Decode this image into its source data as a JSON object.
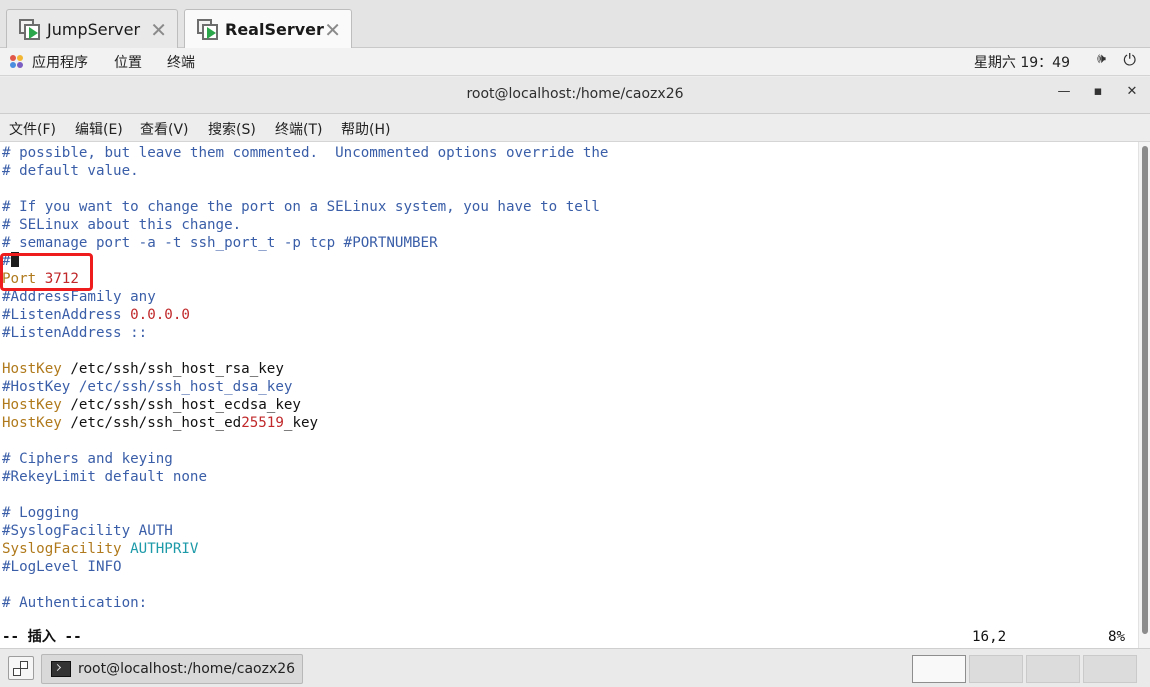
{
  "vm_tabs": [
    {
      "label": "JumpServer",
      "close": "✕",
      "active": false
    },
    {
      "label": "RealServer",
      "close": "✕",
      "active": true
    }
  ],
  "topbar": {
    "menus": [
      "应用程序",
      "位置",
      "终端"
    ],
    "clock": "星期六 19：49"
  },
  "window": {
    "title": "root@localhost:/home/caozx26",
    "minimize": "—",
    "maximize": "▪",
    "close": "✕"
  },
  "menubar": [
    "文件(F)",
    "编辑(E)",
    "查看(V)",
    "搜索(S)",
    "终端(T)",
    "帮助(H)"
  ],
  "editor": {
    "lines": [
      "# possible, but leave them commented.  Uncommented options override the",
      "# default value.",
      "",
      "# If you want to change the port on a SELinux system, you have to tell",
      "# SELinux about this change.",
      "# semanage port -a -t ssh_port_t -p tcp #PORTNUMBER",
      "#",
      [
        "Port",
        "3712"
      ],
      "#AddressFamily any",
      [
        "#ListenAddress",
        "0.0.0.0"
      ],
      "#ListenAddress ::",
      "",
      [
        "HostKey",
        "/etc/ssh/ssh_host_rsa_key"
      ],
      "#HostKey /etc/ssh/ssh_host_dsa_key",
      [
        "HostKey",
        "/etc/ssh/ssh_host_ecdsa_key"
      ],
      [
        "HostKey",
        "/etc/ssh/ssh_host_ed",
        "25519",
        "_key"
      ],
      "",
      "# Ciphers and keying",
      "#RekeyLimit default none",
      "",
      "# Logging",
      "#SyslogFacility AUTH",
      [
        "SyslogFacility",
        "AUTHPRIV"
      ],
      "#LogLevel INFO",
      "",
      "# Authentication:"
    ],
    "mode": "-- 插入 --",
    "position": "16,2",
    "percent": "8%"
  },
  "taskbar": {
    "task_label": "root@localhost:/home/caozx26"
  },
  "colors": {
    "comment": "#3a5ea8",
    "keyword": "#b07a1c",
    "number": "#c0282a",
    "value": "#1d9aa8",
    "highlight": "#ee1c1c"
  }
}
